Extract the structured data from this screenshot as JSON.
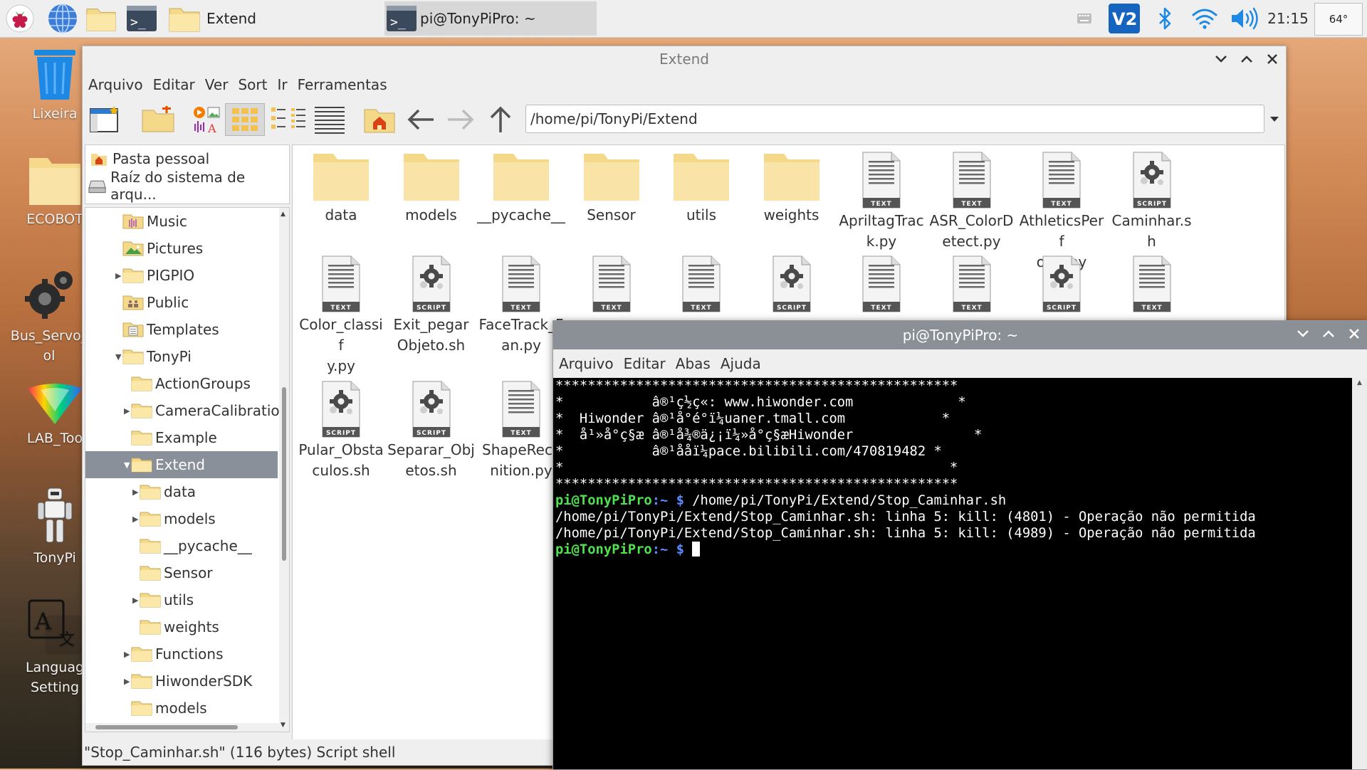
{
  "taskbar": {
    "tasks": [
      {
        "label": "Extend"
      },
      {
        "label": "pi@TonyPiPro: ~"
      }
    ],
    "clock": "21:15",
    "cpu": "64°"
  },
  "desktop": {
    "icons": [
      {
        "label": "Lixeira"
      },
      {
        "label": "ECOBOT"
      },
      {
        "label": "Bus_Servo_\nol"
      },
      {
        "label": "LAB_Too"
      },
      {
        "label": "TonyPi"
      },
      {
        "label": "Languag\nSetting"
      }
    ]
  },
  "file_manager": {
    "title": "Extend",
    "menu": [
      "Arquivo",
      "Editar",
      "Ver",
      "Sort",
      "Ir",
      "Ferramentas"
    ],
    "path": "/home/pi/TonyPi/Extend",
    "places": [
      "Pasta pessoal",
      "Raíz do sistema de arqu..."
    ],
    "tree": [
      {
        "label": "Music",
        "depth": 1,
        "arrow": ""
      },
      {
        "label": "Pictures",
        "depth": 1,
        "arrow": ""
      },
      {
        "label": "PIGPIO",
        "depth": 1,
        "arrow": "right"
      },
      {
        "label": "Public",
        "depth": 1,
        "arrow": ""
      },
      {
        "label": "Templates",
        "depth": 1,
        "arrow": ""
      },
      {
        "label": "TonyPi",
        "depth": 1,
        "arrow": "down"
      },
      {
        "label": "ActionGroups",
        "depth": 2,
        "arrow": ""
      },
      {
        "label": "CameraCalibratio",
        "depth": 2,
        "arrow": "right"
      },
      {
        "label": "Example",
        "depth": 2,
        "arrow": ""
      },
      {
        "label": "Extend",
        "depth": 2,
        "arrow": "down",
        "selected": true
      },
      {
        "label": "data",
        "depth": 3,
        "arrow": "right"
      },
      {
        "label": "models",
        "depth": 3,
        "arrow": "right"
      },
      {
        "label": "__pycache__",
        "depth": 3,
        "arrow": ""
      },
      {
        "label": "Sensor",
        "depth": 3,
        "arrow": ""
      },
      {
        "label": "utils",
        "depth": 3,
        "arrow": "right"
      },
      {
        "label": "weights",
        "depth": 3,
        "arrow": ""
      },
      {
        "label": "Functions",
        "depth": 2,
        "arrow": "right"
      },
      {
        "label": "HiwonderSDK",
        "depth": 2,
        "arrow": "right"
      },
      {
        "label": "models",
        "depth": 2,
        "arrow": ""
      }
    ],
    "files": [
      {
        "name": "data",
        "type": "folder"
      },
      {
        "name": "models",
        "type": "folder"
      },
      {
        "name": "__pycache__",
        "type": "folder"
      },
      {
        "name": "Sensor",
        "type": "folder"
      },
      {
        "name": "utils",
        "type": "folder"
      },
      {
        "name": "weights",
        "type": "folder"
      },
      {
        "name": "ApriltagTrac\nk.py",
        "type": "text"
      },
      {
        "name": "ASR_ColorD\netect.py",
        "type": "text"
      },
      {
        "name": "AthleticsPerf\norm.py",
        "type": "text"
      },
      {
        "name": "Caminhar.sh",
        "type": "script"
      },
      {
        "name": "Color_classif\ny.py",
        "type": "text"
      },
      {
        "name": "Exit_pegar\nObjeto.sh",
        "type": "script"
      },
      {
        "name": "FaceTrack_F\nan.py",
        "type": "text"
      },
      {
        "name": "",
        "type": "text"
      },
      {
        "name": "",
        "type": "text"
      },
      {
        "name": "",
        "type": "script"
      },
      {
        "name": "",
        "type": "text"
      },
      {
        "name": "",
        "type": "text"
      },
      {
        "name": "",
        "type": "script"
      },
      {
        "name": "",
        "type": "text"
      },
      {
        "name": "Pular_Obsta\nculos.sh",
        "type": "script"
      },
      {
        "name": "Separar_Obj\netos.sh",
        "type": "script"
      },
      {
        "name": "ShapeRecc\nnition.py",
        "type": "text"
      }
    ],
    "badges": {
      "text": "TEXT",
      "script": "SCRIPT"
    },
    "status": "\"Stop_Caminhar.sh\" (116 bytes) Script shell"
  },
  "terminal": {
    "title": "pi@TonyPiPro: ~",
    "menu": [
      "Arquivo",
      "Editar",
      "Abas",
      "Ajuda"
    ],
    "banner": [
      "**************************************************",
      "*           â®¹ç½ç«: www.hiwonder.com             *",
      "*  Hiwonder â®¹å°é°ï¼uaner.tmall.com            *",
      "*  å¹»å°ç§æ â®¹å¾®ä¿¡ï¼»å°ç§æHiwonder               *",
      "*           â®¹ååï¼pace.bilibili.com/470819482 *",
      "*                                                *",
      "**************************************************"
    ],
    "prompt_user": "pi@TonyPiPro",
    "prompt_path": ":~ $",
    "command": " /home/pi/TonyPi/Extend/Stop_Caminhar.sh",
    "output": [
      "/home/pi/TonyPi/Extend/Stop_Caminhar.sh: linha 5: kill: (4801) - Operação não permitida",
      "/home/pi/TonyPi/Extend/Stop_Caminhar.sh: linha 5: kill: (4989) - Operação não permitida"
    ]
  }
}
